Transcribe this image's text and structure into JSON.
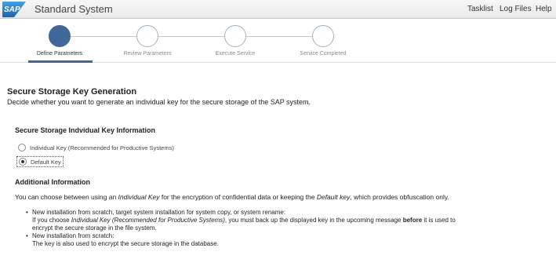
{
  "header": {
    "logo_text": "SAP",
    "title": "Standard System",
    "links": [
      "Tasklist",
      "Log Files",
      "Help"
    ]
  },
  "roadmap": {
    "steps": [
      {
        "label": "Define Parameters",
        "state": "active"
      },
      {
        "label": "Review Parameters",
        "state": "inactive"
      },
      {
        "label": "Execute Service",
        "state": "inactive"
      },
      {
        "label": "Service Completed",
        "state": "inactive"
      }
    ]
  },
  "section": {
    "title": "Secure Storage Key Generation",
    "description": "Decide whether you want to generate an individual key for the secure storage of the SAP system."
  },
  "key_info": {
    "title": "Secure Storage Indvidual Key Information",
    "options": [
      {
        "label": "Individual Key (Recommended for Productive Systems)",
        "checked": false
      },
      {
        "label": "Default Key",
        "checked": true
      }
    ]
  },
  "additional": {
    "title": "Additional Information",
    "para_1": "You can choose between using an ",
    "para_2": "Individual Key",
    "para_3": " for the encryption of confidential data or keeping the ",
    "para_4": "Default key",
    "para_5": ", which provides obfuscation only.",
    "bullet1_l1": "New installation from scratch, target system installation for system copy, or system rename:",
    "bullet1_l2a": "If you choose ",
    "bullet1_l2b": "Individual Key (Recommended for Productive Systems)",
    "bullet1_l2c": ", you must back up the displayed key in the upcoming message ",
    "bullet1_l2d": "before",
    "bullet1_l2e": " it is used to",
    "bullet1_l3": "encrypt the secure storage in the file system.",
    "bullet2_l1": "New installation from scratch:",
    "bullet2_l2": "The key is also used to encrypt the secure storage in the database."
  },
  "colors": {
    "accent": "#3f6899",
    "logo_blue": "#1a7fd6"
  },
  "icons": [
    "sap-logo"
  ]
}
